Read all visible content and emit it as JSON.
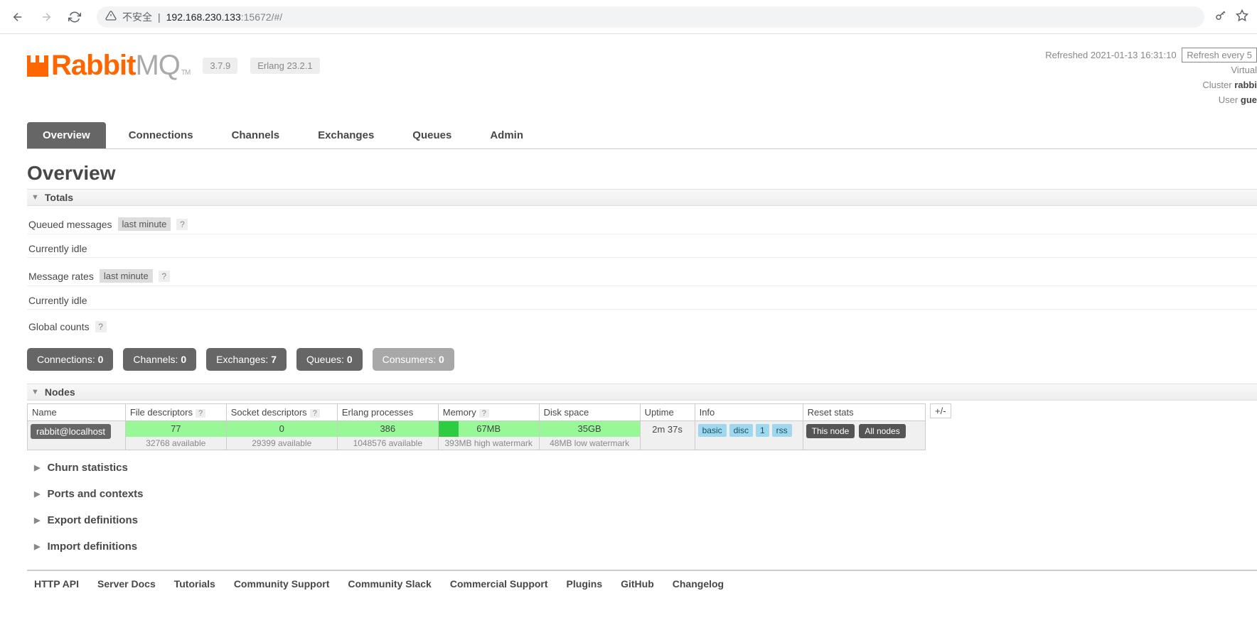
{
  "browser": {
    "url_insecure_label": "不安全",
    "url_host": "192.168.230.133",
    "url_port": ":15672",
    "url_path": "/#/"
  },
  "header": {
    "logo_rabbit": "Rabbit",
    "logo_mq": "MQ",
    "logo_tm": "TM",
    "version": "3.7.9",
    "erlang": "Erlang 23.2.1"
  },
  "status": {
    "refreshed_label": "Refreshed",
    "refreshed_time": "2021-01-13 16:31:10",
    "refresh_select": "Refresh every 5",
    "virtual_label": "Virtual",
    "cluster_label": "Cluster",
    "cluster_value": "rabbi",
    "user_label": "User",
    "user_value": "gue"
  },
  "tabs": [
    "Overview",
    "Connections",
    "Channels",
    "Exchanges",
    "Queues",
    "Admin"
  ],
  "page_title": "Overview",
  "sections": {
    "totals": "Totals",
    "nodes": "Nodes",
    "churn": "Churn statistics",
    "ports": "Ports and contexts",
    "export": "Export definitions",
    "import": "Import definitions"
  },
  "totals": {
    "queued_label": "Queued messages",
    "queued_chip": "last minute",
    "queued_idle": "Currently idle",
    "rates_label": "Message rates",
    "rates_chip": "last minute",
    "rates_idle": "Currently idle",
    "global_label": "Global counts",
    "help": "?"
  },
  "counts": {
    "connections_label": "Connections:",
    "connections_value": "0",
    "channels_label": "Channels:",
    "channels_value": "0",
    "exchanges_label": "Exchanges:",
    "exchanges_value": "7",
    "queues_label": "Queues:",
    "queues_value": "0",
    "consumers_label": "Consumers:",
    "consumers_value": "0"
  },
  "nodes": {
    "headers": {
      "name": "Name",
      "fd": "File descriptors",
      "sd": "Socket descriptors",
      "ep": "Erlang processes",
      "mem": "Memory",
      "disk": "Disk space",
      "uptime": "Uptime",
      "info": "Info",
      "reset": "Reset stats",
      "plusminus": "+/-"
    },
    "row": {
      "name": "rabbit@localhost",
      "fd_val": "77",
      "fd_sub": "32768 available",
      "sd_val": "0",
      "sd_sub": "29399 available",
      "ep_val": "386",
      "ep_sub": "1048576 available",
      "mem_val": "67MB",
      "mem_sub": "393MB high watermark",
      "disk_val": "35GB",
      "disk_sub": "48MB low watermark",
      "uptime": "2m 37s",
      "info_tags": [
        "basic",
        "disc",
        "1",
        "rss"
      ],
      "reset_this": "This node",
      "reset_all": "All nodes"
    }
  },
  "footer": [
    "HTTP API",
    "Server Docs",
    "Tutorials",
    "Community Support",
    "Community Slack",
    "Commercial Support",
    "Plugins",
    "GitHub",
    "Changelog"
  ]
}
